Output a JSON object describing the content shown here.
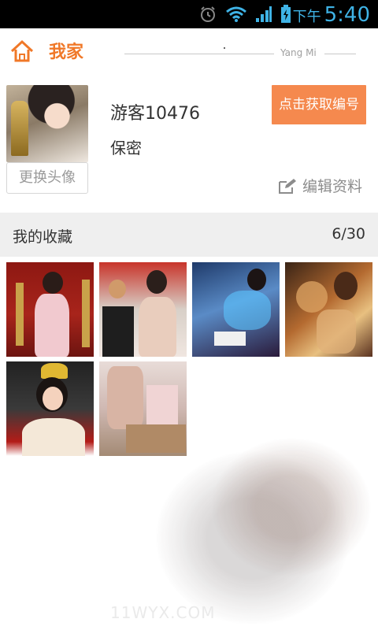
{
  "status_bar": {
    "ampm": "下午",
    "time": "5:40",
    "icons": [
      "alarm-icon",
      "wifi-icon",
      "signal-icon",
      "battery-charging-icon"
    ]
  },
  "header": {
    "title": "我家",
    "subtitle": "Yang Mi",
    "icon": "home-icon",
    "accent_color": "#f07828"
  },
  "profile": {
    "username": "游客10476",
    "gender": "保密",
    "change_avatar_label": "更换头像",
    "get_id_label": "点击获取编号",
    "edit_label": "编辑资料",
    "button_color": "#f5894e"
  },
  "favorites": {
    "title": "我的收藏",
    "count": "6/30",
    "items": [
      "thumb-1",
      "thumb-2",
      "thumb-3",
      "thumb-4",
      "thumb-5",
      "thumb-6"
    ]
  },
  "footer": {
    "watermark": "11WYX.COM"
  }
}
